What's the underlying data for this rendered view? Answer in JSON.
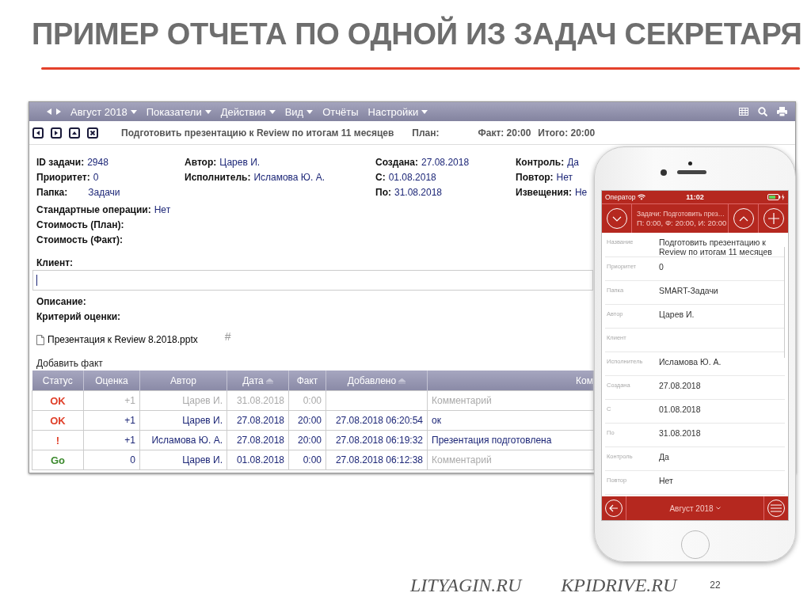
{
  "slide": {
    "title": "ПРИМЕР ОТЧЕТА ПО ОДНОЙ ИЗ ЗАДАЧ СЕКРЕТАРЯ",
    "sites": [
      "LITYAGIN.RU",
      "KPIDRIVE.RU"
    ],
    "page": "22"
  },
  "desktop": {
    "menu": [
      {
        "label": "Август 2018",
        "dropdown": true
      },
      {
        "label": "Показатели",
        "dropdown": true
      },
      {
        "label": "Действия",
        "dropdown": true
      },
      {
        "label": "Вид",
        "dropdown": true
      },
      {
        "label": "Отчёты",
        "dropdown": false
      },
      {
        "label": "Настройки",
        "dropdown": true
      }
    ],
    "task": {
      "title": "Подготовить презентацию к Review по итогам 11 месяцев",
      "plan": "План:",
      "fact": "Факт: 20:00",
      "total": "Итого: 20:00"
    },
    "fields": [
      [
        {
          "label": "ID задачи:",
          "value": "2948"
        },
        {
          "label": "Приоритет:",
          "value": "0"
        },
        {
          "label": "Папка:",
          "value": "Задачи"
        }
      ],
      [
        {
          "label": "Автор:",
          "value": "Царев И."
        },
        {
          "label": "Исполнитель:",
          "value": "Исламова Ю. А."
        }
      ],
      [
        {
          "label": "Создана:",
          "value": "27.08.2018"
        },
        {
          "label": "С:",
          "value": "01.08.2018"
        },
        {
          "label": "По:",
          "value": "31.08.2018"
        }
      ],
      [
        {
          "label": "Контроль:",
          "value": "Да"
        },
        {
          "label": "Повтор:",
          "value": "Нет"
        },
        {
          "label": "Извещения:",
          "value": "Не"
        }
      ]
    ],
    "extra_fields": [
      {
        "label": "Стандартные операции:",
        "value": "Нет"
      },
      {
        "label": "Стоимость (План):"
      },
      {
        "label": "Стоимость (Факт):"
      }
    ],
    "client_label": "Клиент:",
    "description_label": "Описание:",
    "criterion_label": "Критерий оценки:",
    "attachment": {
      "name": "Презентация к Review 8.2018.pptx",
      "tag": "#"
    },
    "add_fact": "Добавить факт",
    "table": {
      "columns": [
        {
          "label": "Статус",
          "sorted": false
        },
        {
          "label": "Оценка",
          "sorted": false
        },
        {
          "label": "Автор",
          "sorted": false
        },
        {
          "label": "Дата",
          "sorted": true
        },
        {
          "label": "Факт",
          "sorted": false
        },
        {
          "label": "Добавлено",
          "sorted": true
        },
        {
          "label": "Ком",
          "sorted": false
        }
      ],
      "rows": [
        {
          "muted": true,
          "status": {
            "text": "OK",
            "color": "#e0402a"
          },
          "score": "+1",
          "author": "Царев И.",
          "date": "31.08.2018",
          "fact": "0:00",
          "comment": {
            "text": "Комментарий"
          }
        },
        {
          "muted": false,
          "status": {
            "text": "OK",
            "color": "#e0402a"
          },
          "score": "+1",
          "author": "Царев И.",
          "date": "27.08.2018",
          "fact": "20:00",
          "added": "27.08.2018 06:20:54",
          "comment": {
            "text": "ок",
            "placeholder": false
          }
        },
        {
          "muted": false,
          "status": {
            "text": "!",
            "color": "#e0402a"
          },
          "score": "+1",
          "author": "Исламова Ю. А.",
          "date": "27.08.2018",
          "fact": "20:00",
          "added": "27.08.2018 06:19:32",
          "comment": {
            "text": "Презентация подготовлена",
            "placeholder": false
          }
        },
        {
          "muted": false,
          "status": {
            "text": "Go",
            "color": "#3c8a2e"
          },
          "score": "0",
          "author": "Царев И.",
          "date": "01.08.2018",
          "fact": "0:00",
          "added": "27.08.2018 06:12:38",
          "comment": {
            "text": "Комментарий",
            "placeholder": true
          }
        }
      ]
    }
  },
  "phone": {
    "status_bar": {
      "carrier": "Оператор",
      "time": "11:02"
    },
    "header": {
      "title": "Задачи: Подготовить през…",
      "summary": "П: 0:00, Ф: 20:00, И: 20:00"
    },
    "fields": [
      {
        "label": "Название",
        "value": "Подготовить презентацию к Review по итогам 11 месяцев"
      },
      {
        "label": "Приоритет",
        "value": "0"
      },
      {
        "label": "Папка",
        "value": "SMART-Задачи"
      },
      {
        "label": "Автор",
        "value": "Царев И."
      },
      {
        "label": "Клиент"
      },
      {
        "label": "Исполнитель",
        "value": "Исламова Ю. А."
      },
      {
        "label": "Создана",
        "value": "27.08.2018"
      },
      {
        "label": "С",
        "value": "01.08.2018"
      },
      {
        "label": "По",
        "value": "31.08.2018"
      },
      {
        "label": "Контроль",
        "value": "Да"
      },
      {
        "label": "Повтор",
        "value": "Нет"
      }
    ],
    "footer": {
      "period": "Август 2018"
    }
  }
}
